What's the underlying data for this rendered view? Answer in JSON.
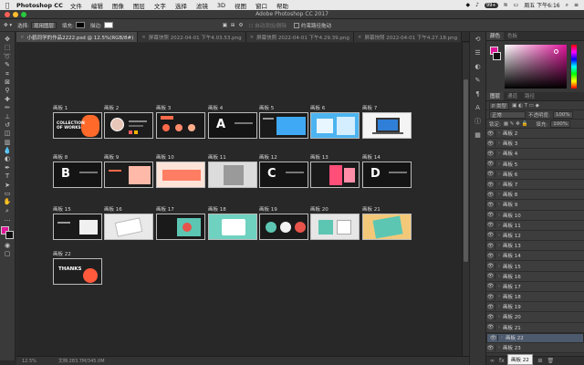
{
  "menubar": {
    "app_name": "Photoshop CC",
    "items": [
      "文件",
      "编辑",
      "图像",
      "图层",
      "文字",
      "选择",
      "滤镜",
      "3D",
      "视图",
      "窗口",
      "帮助"
    ],
    "badge": "99+",
    "datetime": "周五 下午6:16"
  },
  "window": {
    "title": "Adobe Photoshop CC 2017"
  },
  "options": {
    "select_label": "选择:",
    "select_value": "现用图层",
    "fill_label": "填充:",
    "stroke_label": "描边:",
    "path_ops_label": "约束路径拖动"
  },
  "tabs": [
    {
      "label": "小鹤同学的作品2222.psd @ 12.5%(RGB/8#)",
      "active": true
    },
    {
      "label": "屏幕快照 2022-04-01 下午4.03.53.png",
      "active": false
    },
    {
      "label": "屏幕快照 2022-04-01 下午4.29.39.png",
      "active": false
    },
    {
      "label": "屏幕快照 2022-04-01 下午4.27.18.png",
      "active": false
    }
  ],
  "artboards": [
    {
      "label": "画板 1",
      "thumb_text": "COLLECTION\nOF WORKS"
    },
    {
      "label": "画板 2",
      "thumb_text": ""
    },
    {
      "label": "画板 3",
      "thumb_text": ""
    },
    {
      "label": "画板 4",
      "thumb_text": "A"
    },
    {
      "label": "画板 5",
      "thumb_text": ""
    },
    {
      "label": "画板 6",
      "thumb_text": ""
    },
    {
      "label": "画板 7",
      "thumb_text": ""
    },
    {
      "label": "画板 8",
      "thumb_text": "B"
    },
    {
      "label": "画板 9",
      "thumb_text": ""
    },
    {
      "label": "画板 10",
      "thumb_text": ""
    },
    {
      "label": "画板 11",
      "thumb_text": ""
    },
    {
      "label": "画板 12",
      "thumb_text": "C"
    },
    {
      "label": "画板 13",
      "thumb_text": ""
    },
    {
      "label": "画板 14",
      "thumb_text": "D"
    },
    {
      "label": "画板 15",
      "thumb_text": ""
    },
    {
      "label": "画板 16",
      "thumb_text": ""
    },
    {
      "label": "画板 17",
      "thumb_text": ""
    },
    {
      "label": "画板 18",
      "thumb_text": ""
    },
    {
      "label": "画板 19",
      "thumb_text": ""
    },
    {
      "label": "画板 20",
      "thumb_text": ""
    },
    {
      "label": "画板 21",
      "thumb_text": ""
    },
    {
      "label": "画板 22",
      "thumb_text": "THANKS"
    }
  ],
  "status": {
    "zoom": "12.5%",
    "doc": "文档:283.7M/345.0M"
  },
  "panels": {
    "color_tabs": [
      "颜色",
      "色板"
    ],
    "layer_tabs": [
      "图层",
      "通道",
      "路径"
    ],
    "kind_label": "P 类型",
    "blend_mode": "正常",
    "opacity_label": "不透明度:",
    "opacity_value": "100%",
    "lock_label": "锁定:",
    "fill_label": "填充:",
    "fill_value": "100%"
  },
  "layers": [
    "画板 2",
    "画板 3",
    "画板 4",
    "画板 5",
    "画板 6",
    "画板 7",
    "画板 8",
    "画板 9",
    "画板 10",
    "画板 11",
    "画板 12",
    "画板 13",
    "画板 14",
    "画板 15",
    "画板 16",
    "画板 17",
    "画板 18",
    "画板 19",
    "画板 20",
    "画板 21",
    "画板 22",
    "画板 23"
  ],
  "tooltip": "画板 22",
  "colors": {
    "foreground": "#e0169a",
    "background": "#111111"
  }
}
